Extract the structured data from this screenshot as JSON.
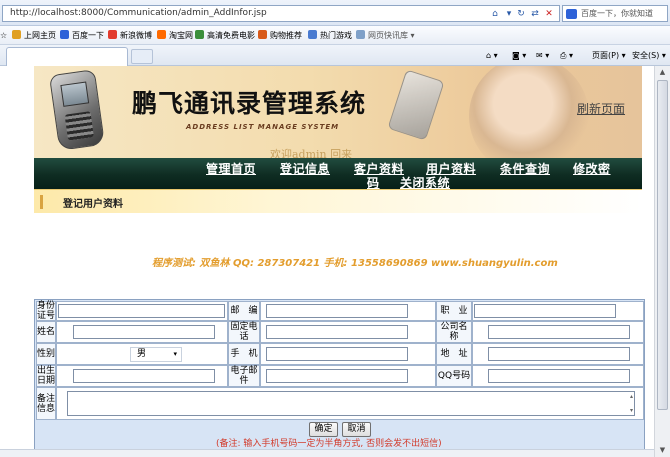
{
  "browser": {
    "address": "http://localhost:8000/Communication/admin_AddInfor.jsp",
    "search_placeholder": "百度一下，你就知道",
    "favorites": [
      {
        "label": "上网主页",
        "color": "#e0a023"
      },
      {
        "label": "百度一下",
        "color": "#2e62d8"
      },
      {
        "label": "新浪微博",
        "color": "#e23b2e"
      },
      {
        "label": "淘宝网",
        "color": "#ff6a00"
      },
      {
        "label": "高清免费电影",
        "color": "#3b8f3b"
      },
      {
        "label": "购物推荐",
        "color": "#d85a1a"
      },
      {
        "label": "热门游戏",
        "color": "#4a7bd1"
      },
      {
        "label": "网页快讯库 ▾",
        "color": "#7fa0c8"
      }
    ],
    "tools": {
      "page": "页面(P) ▾",
      "safety": "安全(S) ▾"
    }
  },
  "banner": {
    "title": "鹏飞通讯录管理系统",
    "subtitle": "ADDRESS  LIST MANAGE SYSTEM",
    "welcome": "欢迎admin 回来",
    "refresh_link": "刷新页面"
  },
  "nav": [
    "管理首页",
    "登记信息",
    "客户资料",
    "用户资料",
    "条件查询",
    "修改密",
    "码",
    "关闭系统"
  ],
  "section_title": "登记用户资料",
  "credits": "程序测试: 双鱼林   QQ: 287307421   手机: 13558690869   www.shuangyulin.com",
  "form": {
    "labels": {
      "id_card": "身份证号",
      "postcode": "邮　编",
      "job": "职　业",
      "name": "姓名",
      "tel": "固定电话",
      "company": "公司名称",
      "gender": "性别",
      "mobile": "手　机",
      "address": "地　址",
      "birthday": "出生日期",
      "email": "电子邮件",
      "qq": "QQ号码",
      "remark": "备注信息"
    },
    "gender_value": "男",
    "submit": "确定",
    "cancel": "取消",
    "note": "(备注: 输入手机号码一定为半角方式, 否则会发不出短信)"
  },
  "colors": {
    "nav_bg": "#0f2c22",
    "form_bg": "#d7e4f5",
    "credits": "#e39d2d",
    "note": "#d23a2a"
  }
}
